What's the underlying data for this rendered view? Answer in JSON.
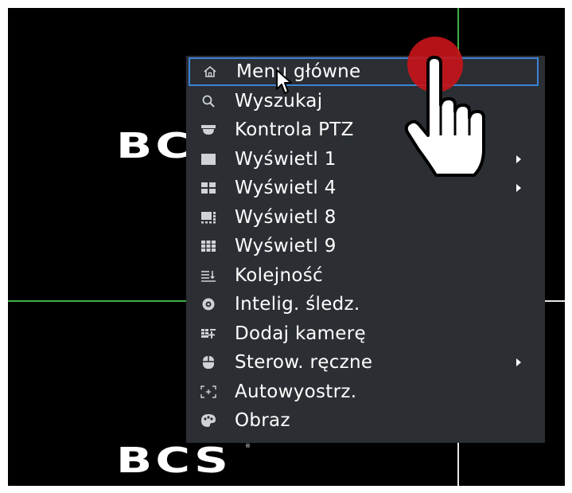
{
  "logo": {
    "text": "BCS",
    "registered": "®"
  },
  "menu": {
    "items": [
      {
        "label": "Menu główne",
        "icon": "home-icon",
        "submenu": false,
        "active": true
      },
      {
        "label": "Wyszukaj",
        "icon": "search-icon",
        "submenu": false,
        "active": false
      },
      {
        "label": "Kontrola PTZ",
        "icon": "ptz-camera-icon",
        "submenu": false,
        "active": false
      },
      {
        "label": "Wyświetl 1",
        "icon": "single-view-icon",
        "submenu": true,
        "active": false
      },
      {
        "label": "Wyświetl 4",
        "icon": "quad-view-icon",
        "submenu": true,
        "active": false
      },
      {
        "label": "Wyświetl 8",
        "icon": "eight-view-icon",
        "submenu": false,
        "active": false
      },
      {
        "label": "Wyświetl 9",
        "icon": "nine-view-icon",
        "submenu": false,
        "active": false
      },
      {
        "label": "Kolejność",
        "icon": "sequence-icon",
        "submenu": false,
        "active": false
      },
      {
        "label": "Intelig. śledz.",
        "icon": "smart-track-icon",
        "submenu": false,
        "active": false
      },
      {
        "label": "Dodaj kamerę",
        "icon": "add-camera-icon",
        "submenu": false,
        "active": false
      },
      {
        "label": "Sterow. ręczne",
        "icon": "manual-control-icon",
        "submenu": true,
        "active": false
      },
      {
        "label": "Autowyostrz.",
        "icon": "autofocus-icon",
        "submenu": false,
        "active": false
      },
      {
        "label": "Obraz",
        "icon": "image-icon",
        "submenu": false,
        "active": false
      }
    ]
  },
  "colors": {
    "menu_bg": "#2b2f34",
    "active_border": "#3b82d6",
    "grid_line": "#3fb04a",
    "click_indicator": "#c81419"
  }
}
